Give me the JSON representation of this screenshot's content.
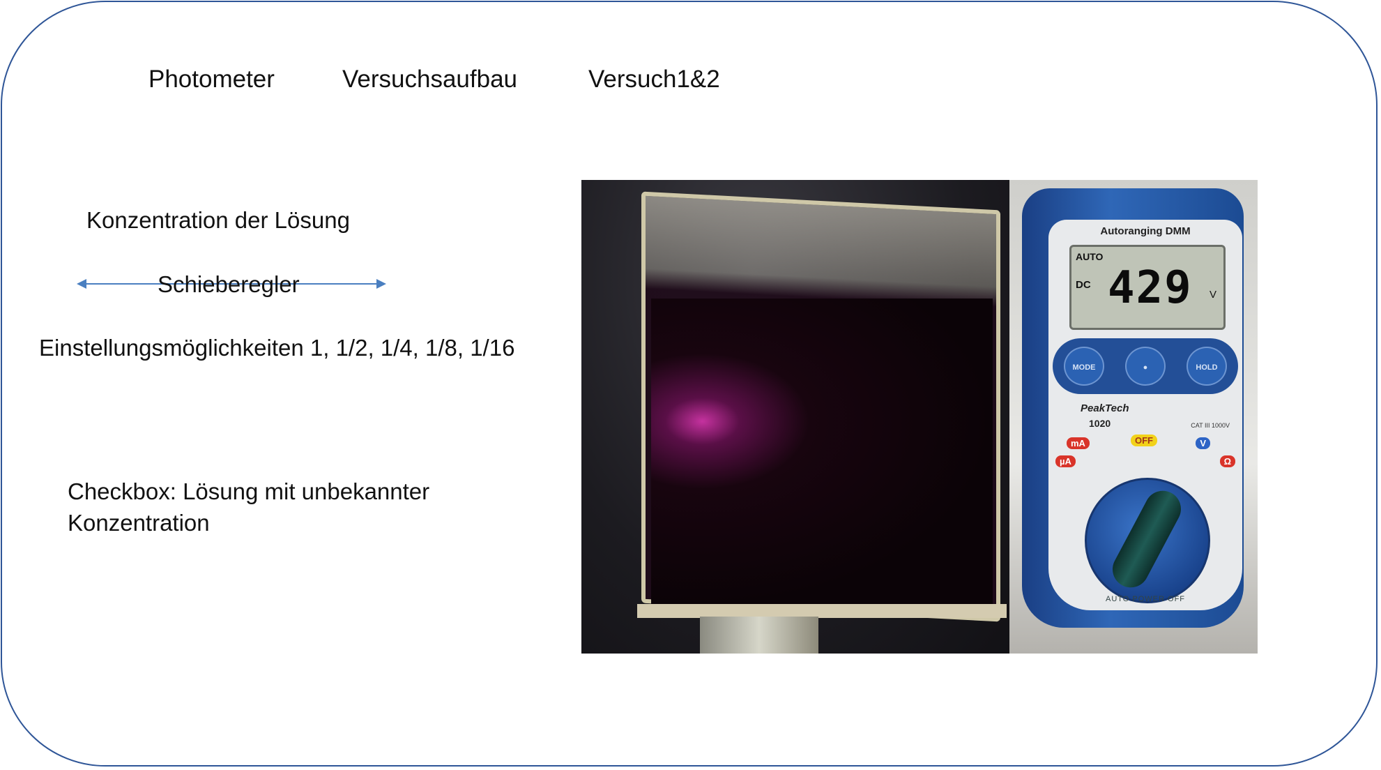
{
  "tabs": [
    "Photometer",
    "Versuchsaufbau",
    "Versuch1&2"
  ],
  "controls": {
    "concentration_label": "Konzentration der Lösung",
    "slider_label": "Schieberegler",
    "options_label": "Einstellungsmöglichkeiten 1, 1/2, 1/4, 1/8, 1/16",
    "checkbox_label": "Checkbox: Lösung mit unbekannter Konzentration"
  },
  "photo": {
    "meter_title": "Autoranging DMM",
    "lcd_mode": "AUTO",
    "lcd_dc": "DC",
    "lcd_value": "429",
    "lcd_unit": "V",
    "btn_mode": "MODE",
    "btn_hold": "HOLD",
    "brand": "PeakTech",
    "model": "1020",
    "category": "CAT III 1000V",
    "tag_off": "OFF",
    "tag_ma": "mA",
    "tag_ua": "µA",
    "tag_v": "V",
    "tag_ohm": "Ω",
    "auto_power_off": "AUTO POWER OFF"
  },
  "colors": {
    "frame": "#2e5597",
    "slider_arrow": "#4a7fc0"
  }
}
